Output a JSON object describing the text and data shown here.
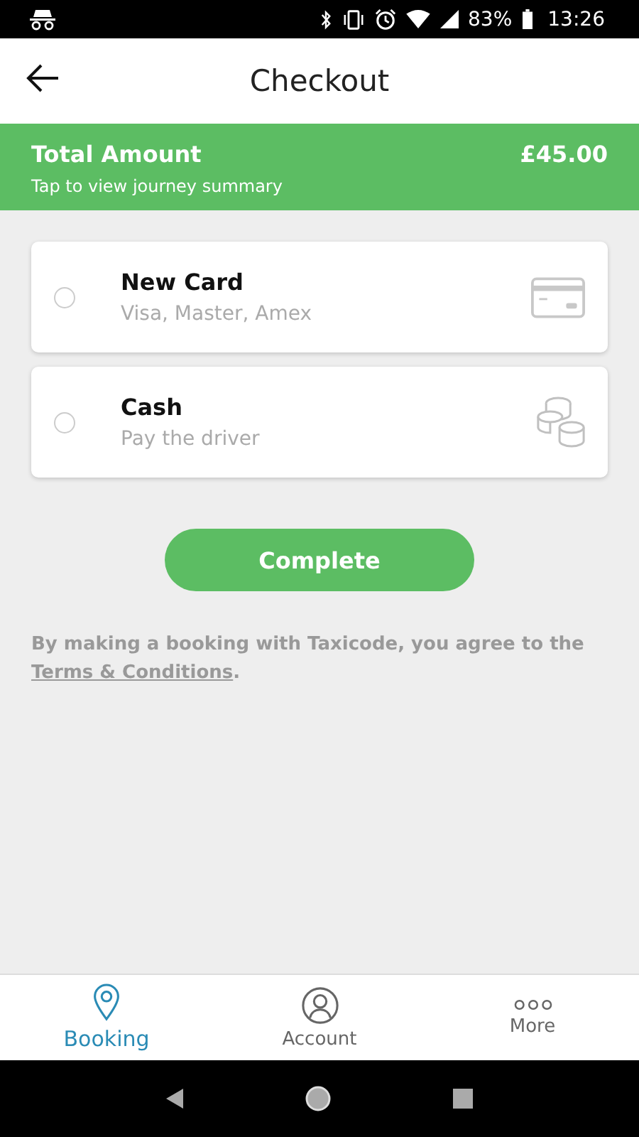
{
  "status_bar": {
    "battery": "83%",
    "time": "13:26"
  },
  "header": {
    "title": "Checkout"
  },
  "summary": {
    "label": "Total Amount",
    "amount": "£45.00",
    "hint": "Tap to view journey summary"
  },
  "payment_options": [
    {
      "kind": "card",
      "title": "New Card",
      "subtitle": "Visa, Master, Amex",
      "selected": false
    },
    {
      "kind": "cash",
      "title": "Cash",
      "subtitle": "Pay the driver",
      "selected": false
    }
  ],
  "complete_button": "Complete",
  "terms": {
    "text": "By making a booking with Taxicode, you agree to the",
    "link": "Terms & Conditions",
    "after": "."
  },
  "bottom_nav": [
    {
      "kind": "booking",
      "label": "Booking",
      "selected": true
    },
    {
      "kind": "account",
      "label": "Account",
      "selected": false
    },
    {
      "kind": "more",
      "label": "More",
      "selected": false
    }
  ]
}
